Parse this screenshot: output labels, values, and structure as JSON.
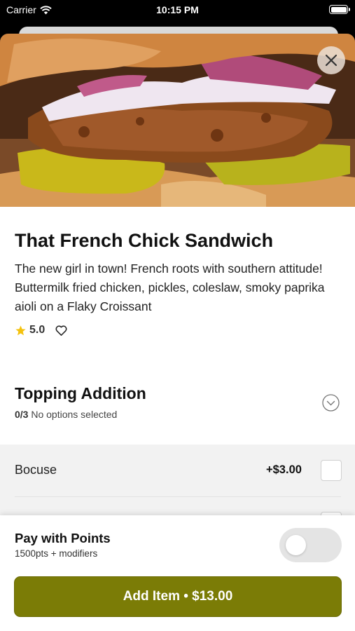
{
  "status_bar": {
    "carrier": "Carrier",
    "time": "10:15 PM"
  },
  "product": {
    "title": "That French Chick Sandwich",
    "description": "The new girl in town! French roots with southern attitude! Buttermilk fried chicken, pickles, coleslaw, smoky paprika aioli on a Flaky Croissant",
    "rating": "5.0"
  },
  "topping_section": {
    "title": "Topping Addition",
    "count": "0/3",
    "status": "No options selected",
    "options": [
      {
        "name": "Bocuse",
        "price": "+$3.00"
      }
    ]
  },
  "bottom_panel": {
    "pay_title": "Pay with Points",
    "pay_sub": "1500pts + modifiers",
    "toggle_on": false,
    "add_button_label": "Add Item • $13.00"
  },
  "colors": {
    "accent": "#7b7c06",
    "star": "#f4c20d"
  },
  "icons": [
    "wifi-icon",
    "battery-icon",
    "close-icon",
    "star-icon",
    "heart-icon",
    "chevron-down-icon"
  ]
}
